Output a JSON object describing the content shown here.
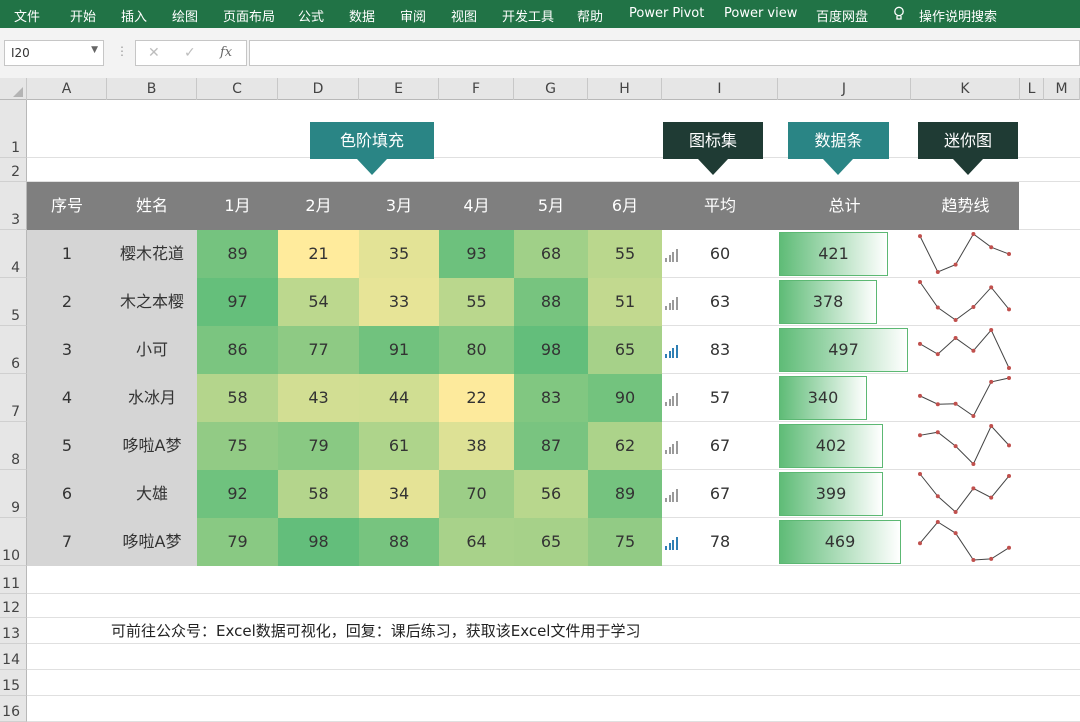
{
  "menu": [
    "文件",
    "开始",
    "插入",
    "绘图",
    "页面布局",
    "公式",
    "数据",
    "审阅",
    "视图",
    "开发工具",
    "帮助",
    "Power Pivot",
    "Power view",
    "百度网盘",
    "操作说明搜索"
  ],
  "formula_bar": {
    "name_box": "I20",
    "cancel": "✕",
    "confirm": "✓",
    "fx": "fx",
    "formula": ""
  },
  "columns": [
    "A",
    "B",
    "C",
    "D",
    "E",
    "F",
    "G",
    "H",
    "I",
    "J",
    "K",
    "L",
    "M"
  ],
  "rows": [
    "1",
    "2",
    "3",
    "4",
    "5",
    "6",
    "7",
    "8",
    "9",
    "10",
    "11",
    "12",
    "13",
    "14",
    "15",
    "16"
  ],
  "labels": {
    "color_scale": "色阶填充",
    "icon_set": "图标集",
    "data_bar": "数据条",
    "sparkline": "迷你图"
  },
  "headers": [
    "序号",
    "姓名",
    "1月",
    "2月",
    "3月",
    "4月",
    "5月",
    "6月",
    "平均",
    "总计",
    "趋势线"
  ],
  "colors": {
    "accent": "#217346",
    "teal": "#2a8585",
    "dark": "#1f3b34",
    "header_gray": "#7f7f7f",
    "index_gray": "#d5d5d5",
    "scale_low": "#ffeb9c",
    "scale_high": "#63be7b",
    "bar": "#63be7b",
    "icon_blue": "#2f7fb4",
    "spark_line": "#444444",
    "spark_marker": "#c0504d"
  },
  "table": [
    {
      "no": "1",
      "name": "樱木花道",
      "m": [
        "89",
        "21",
        "35",
        "93",
        "68",
        "55"
      ],
      "avg": "60",
      "icon_level": 2,
      "total": "421"
    },
    {
      "no": "2",
      "name": "木之本樱",
      "m": [
        "97",
        "54",
        "33",
        "55",
        "88",
        "51"
      ],
      "avg": "63",
      "icon_level": 2,
      "total": "378"
    },
    {
      "no": "3",
      "name": "小可",
      "m": [
        "86",
        "77",
        "91",
        "80",
        "98",
        "65"
      ],
      "avg": "83",
      "icon_level": 4,
      "total": "497"
    },
    {
      "no": "4",
      "name": "水冰月",
      "m": [
        "58",
        "43",
        "44",
        "22",
        "83",
        "90"
      ],
      "avg": "57",
      "icon_level": 1,
      "total": "340"
    },
    {
      "no": "5",
      "name": "哆啦A梦",
      "m": [
        "75",
        "79",
        "61",
        "38",
        "87",
        "62"
      ],
      "avg": "67",
      "icon_level": 2,
      "total": "402"
    },
    {
      "no": "6",
      "name": "大雄",
      "m": [
        "92",
        "58",
        "34",
        "70",
        "56",
        "89"
      ],
      "avg": "67",
      "icon_level": 2,
      "total": "399"
    },
    {
      "no": "7",
      "name": "哆啦A梦",
      "m": [
        "79",
        "98",
        "88",
        "64",
        "65",
        "75"
      ],
      "avg": "78",
      "icon_level": 4,
      "total": "469"
    }
  ],
  "note": "可前往公众号：Excel数据可视化，回复：课后练习，获取该Excel文件用于学习"
}
